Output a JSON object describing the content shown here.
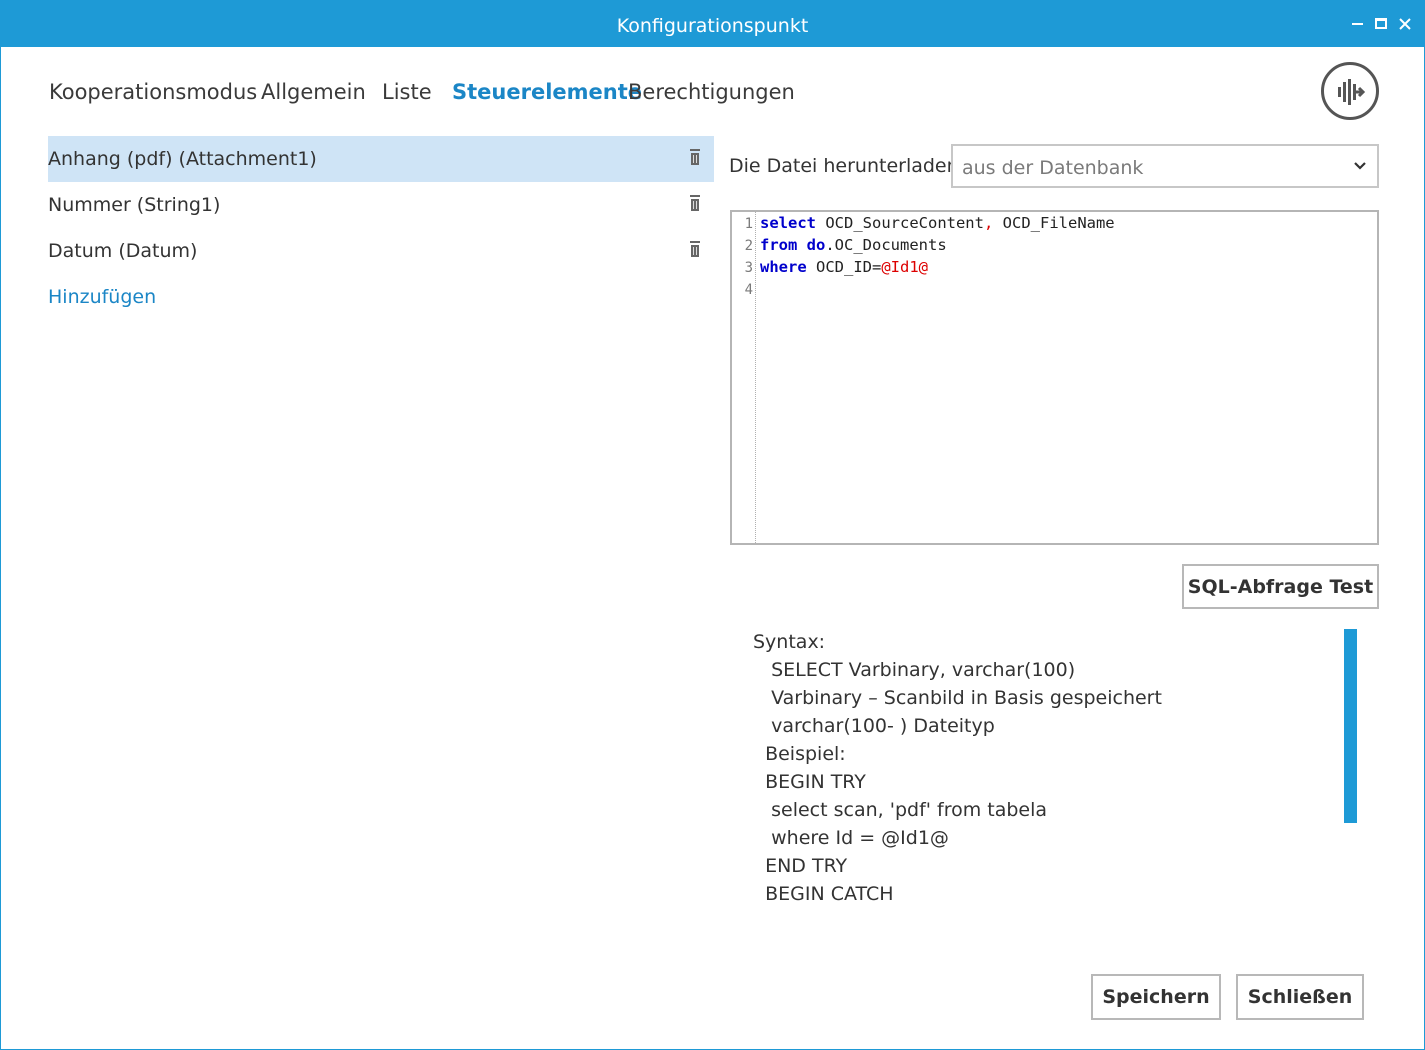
{
  "window": {
    "title": "Konfigurationspunkt"
  },
  "tabs": [
    {
      "label": "Kooperationsmodus"
    },
    {
      "label": "Allgemein"
    },
    {
      "label": "Liste"
    },
    {
      "label": "Steuerelemente",
      "active": true
    },
    {
      "label": "Berechtigungen"
    }
  ],
  "controls": {
    "items": [
      {
        "label": "Anhang (pdf) (Attachment1)",
        "selected": true
      },
      {
        "label": "Nummer (String1)"
      },
      {
        "label": "Datum (Datum)"
      }
    ],
    "add_label": "Hinzufügen"
  },
  "download": {
    "label": "Die Datei herunterladen",
    "selected": "aus der Datenbank"
  },
  "editor": {
    "line_numbers": [
      "1",
      "2",
      "3",
      "4"
    ],
    "lines": [
      "select OCD_SourceContent, OCD_FileName",
      "from do.OC_Documents",
      "where OCD_ID=@Id1@",
      ""
    ]
  },
  "test_button": "SQL-Abfrage Test",
  "syntax_help": [
    "Syntax:",
    "   SELECT Varbinary, varchar(100)",
    "   Varbinary – Scanbild in Basis gespeichert",
    "   varchar(100- ) Dateityp",
    "  Beispiel:",
    "  BEGIN TRY",
    "   select scan, 'pdf' from tabela",
    "   where Id = @Id1@",
    "  END TRY",
    "  BEGIN CATCH"
  ],
  "footer": {
    "save": "Speichern",
    "close": "Schließen"
  },
  "colors": {
    "titlebar": "#1e9ad6",
    "active_tab": "#1b86c6",
    "selected_row": "#cfe4f6",
    "keyword": "#0000cc",
    "literal": "#dd0000"
  },
  "icons": [
    "window-minimize-icon",
    "window-maximize-icon",
    "window-close-icon",
    "app-logo-icon",
    "trash-icon",
    "chevron-down-icon"
  ]
}
